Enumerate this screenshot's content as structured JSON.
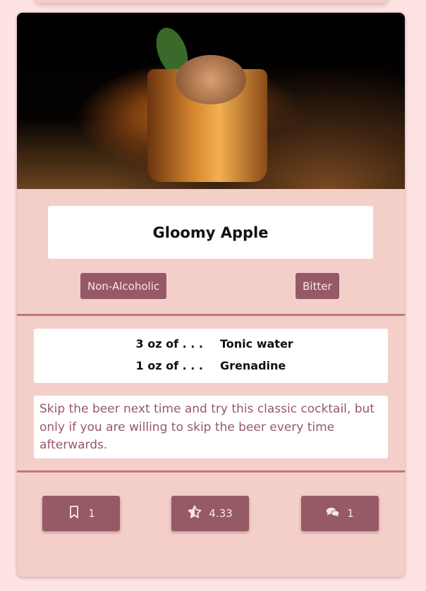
{
  "cocktail": {
    "title": "Gloomy Apple",
    "tags": [
      "Non-Alcoholic",
      "Bitter"
    ],
    "ingredients": [
      {
        "amount": "3 oz of . . .",
        "name": "Tonic water"
      },
      {
        "amount": "1 oz of . . .",
        "name": "Grenadine"
      }
    ],
    "description": "Skip the beer next time and try this classic cocktail, but only if you are willing to skip the beer every time afterwards."
  },
  "actions": {
    "bookmarks": "1",
    "rating": "4.33",
    "comments": "1"
  },
  "colors": {
    "background": "#fde4e3",
    "card": "#f4cfca",
    "accent": "#965966"
  }
}
